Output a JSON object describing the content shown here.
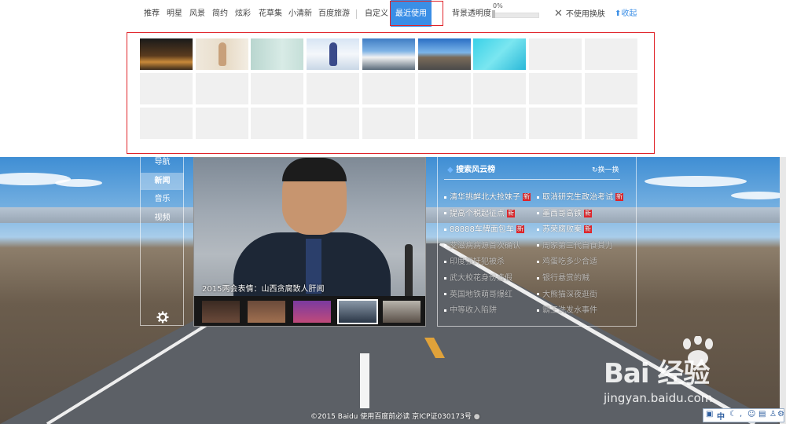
{
  "skin_panel": {
    "tabs": [
      {
        "label": "推荐"
      },
      {
        "label": "明星"
      },
      {
        "label": "风景"
      },
      {
        "label": "简约"
      },
      {
        "label": "炫彩"
      },
      {
        "label": "花草集"
      },
      {
        "label": "小清新"
      },
      {
        "label": "百度旅游"
      },
      {
        "label": "自定义"
      },
      {
        "label": "最近使用",
        "active": true
      }
    ],
    "opacity_label": "背景透明度",
    "opacity_value": "0%",
    "no_skin_label": "不使用换肤",
    "collapse_label": "收起",
    "recent_count": 7,
    "grid_rows": 3,
    "grid_cols": 9
  },
  "sidebar": {
    "items": [
      {
        "label": "导航"
      },
      {
        "label": "新闻",
        "active": true
      },
      {
        "label": "音乐"
      },
      {
        "label": "视频"
      }
    ]
  },
  "news": {
    "caption": "2015两会表情：山西贪腐致人肝闻"
  },
  "hot_search": {
    "title": "搜索风云榜",
    "refresh_label": "换一换",
    "new_badge": "新",
    "left": [
      {
        "text": "清华挑衅北大抢妹子",
        "new": true
      },
      {
        "text": "提高个税起征点",
        "new": true
      },
      {
        "text": "88888车牌面包车",
        "new": true
      },
      {
        "text": "艾滋病病源首次确认"
      },
      {
        "text": "印度强奸犯被杀"
      },
      {
        "text": "武大校花身份造假"
      },
      {
        "text": "英国地铁萌哥爆红"
      },
      {
        "text": "中等收入陷阱"
      }
    ],
    "right": [
      {
        "text": "取消研究生政治考试",
        "new": true
      },
      {
        "text": "墨西哥高铁",
        "new": true
      },
      {
        "text": "苏荣腐败案",
        "new": true
      },
      {
        "text": "周家第三代自食其力"
      },
      {
        "text": "鸡蛋吃多少合适"
      },
      {
        "text": "银行悬赏的贼"
      },
      {
        "text": "大熊猫深夜逛街"
      },
      {
        "text": "霸王洗发水事件"
      }
    ]
  },
  "footer": "©2015 Baidu 使用百度前必读 京ICP证030173号",
  "watermark": {
    "logo": "Bai 经验",
    "url": "jingyan.baidu.com"
  },
  "ime": {
    "mode": "中"
  }
}
